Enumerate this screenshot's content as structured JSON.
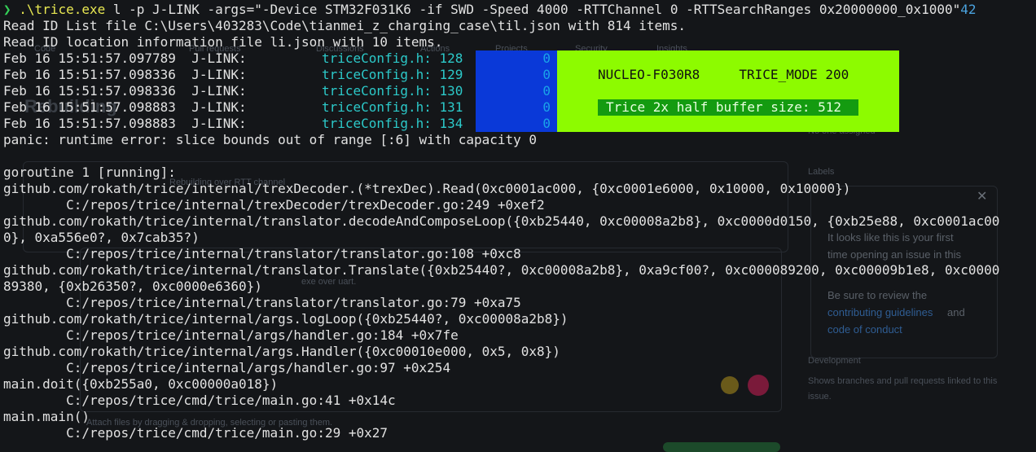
{
  "ghost": {
    "title": "Rebuilding",
    "tabs": [
      "Code",
      "Pull requests",
      "Discussions",
      "Actions",
      "Projects",
      "Security",
      "Insights"
    ],
    "assignees_note": "No one assigned",
    "labels_heading": "Labels",
    "first_time_text_1": "It looks like this is your first",
    "first_time_text_2": "time opening an issue in this",
    "review_text": "Be sure to review the",
    "contributing_link": "contributing guidelines",
    "and_text": "and",
    "conduct_link": "code of conduct",
    "development_heading": "Development",
    "development_text_1": "Shows branches and pull requests linked to this",
    "development_text_2": "issue.",
    "comment_1": "Rebuilding over RTT channel",
    "comment_2": "exe over uart.",
    "attach_hint": "Attach files by dragging & dropping, selecting or pasting them."
  },
  "terminal": {
    "prompt": "❯",
    "command_exe": ".\\trice.exe",
    "command_args": " l -p J-LINK -args=\"-Device STM32F031K6 -if SWD -Speed 4000 -RTTChannel 0 -RTTSearchRanges 0x20000000_0x1000\"",
    "command_suffix": "42",
    "line_til": "Read ID List file C:\\Users\\403283\\Code\\tianmei_z_charging_case\\til.json with 814 items.",
    "line_li": "Read ID location information file li.json with 10 items.",
    "log_rows": [
      {
        "ts": "Feb 16 15:51:57.097789  J-LINK:",
        "cfg": "triceConfig.h: 128",
        "val": "0"
      },
      {
        "ts": "Feb 16 15:51:57.098336  J-LINK:",
        "cfg": "triceConfig.h: 129",
        "val": "0"
      },
      {
        "ts": "Feb 16 15:51:57.098336  J-LINK:",
        "cfg": "triceConfig.h: 130",
        "val": "0"
      },
      {
        "ts": "Feb 16 15:51:57.098883  J-LINK:",
        "cfg": "triceConfig.h: 131",
        "val": "0"
      },
      {
        "ts": "Feb 16 15:51:57.098883  J-LINK:",
        "cfg": "triceConfig.h: 134",
        "val": "0"
      }
    ],
    "panel_board": "NUCLEO-F030R8     TRICE_MODE 200",
    "panel_buffer": "Trice 2x half buffer size: 512",
    "panic": "panic: runtime error: slice bounds out of range [:6] with capacity 0",
    "trace": [
      "",
      "goroutine 1 [running]:",
      "github.com/rokath/trice/internal/trexDecoder.(*trexDec).Read(0xc0001ac000, {0xc0001e6000, 0x10000, 0x10000})",
      "        C:/repos/trice/internal/trexDecoder/trexDecoder.go:249 +0xef2",
      "github.com/rokath/trice/internal/translator.decodeAndComposeLoop({0xb25440, 0xc00008a2b8}, 0xc0000d0150, {0xb25e88, 0xc0001ac00",
      "0}, 0xa556e0?, 0x7cab35?)",
      "        C:/repos/trice/internal/translator/translator.go:108 +0xc8",
      "github.com/rokath/trice/internal/translator.Translate({0xb25440?, 0xc00008a2b8}, 0xa9cf00?, 0xc000089200, 0xc00009b1e8, 0xc0000",
      "89380, {0xb26350?, 0xc0000e6360})",
      "        C:/repos/trice/internal/translator/translator.go:79 +0xa75",
      "github.com/rokath/trice/internal/args.logLoop({0xb25440?, 0xc00008a2b8})",
      "        C:/repos/trice/internal/args/handler.go:184 +0x7fe",
      "github.com/rokath/trice/internal/args.Handler({0xc00010e000, 0x5, 0x8})",
      "        C:/repos/trice/internal/args/handler.go:97 +0x254",
      "main.doit({0xb255a0, 0xc00000a018})",
      "        C:/repos/trice/cmd/trice/main.go:41 +0x14c",
      "main.main()",
      "        C:/repos/trice/cmd/trice/main.go:29 +0x27"
    ]
  }
}
